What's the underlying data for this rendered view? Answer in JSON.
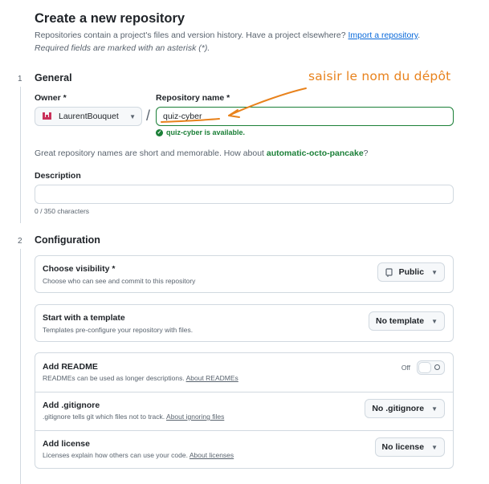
{
  "header": {
    "title": "Create a new repository",
    "intro_text": "Repositories contain a project's files and version history. Have a project elsewhere? ",
    "import_link": "Import a repository",
    "intro_end": ".",
    "required_note": "Required fields are marked with an asterisk (*)."
  },
  "general": {
    "step_number": "1",
    "title": "General",
    "owner_label": "Owner *",
    "owner_value": "LaurentBouquet",
    "slash": "/",
    "repo_label": "Repository name *",
    "repo_value": "quiz-cyber",
    "availability": "quiz-cyber is available.",
    "suggestion_prefix": "Great repository names are short and memorable. How about ",
    "suggestion_name": "automatic-octo-pancake",
    "suggestion_suffix": "?",
    "description_label": "Description",
    "description_value": "",
    "char_count": "0 / 350 characters"
  },
  "configuration": {
    "step_number": "2",
    "title": "Configuration",
    "visibility": {
      "title": "Choose visibility *",
      "subtitle": "Choose who can see and commit to this repository",
      "value": "Public"
    },
    "template": {
      "title": "Start with a template",
      "subtitle": "Templates pre-configure your repository with files.",
      "value": "No template"
    },
    "readme": {
      "title": "Add README",
      "subtitle": "READMEs can be used as longer descriptions. ",
      "link": "About READMEs",
      "toggle_state": "Off"
    },
    "gitignore": {
      "title": "Add .gitignore",
      "subtitle": ".gitignore tells git which files not to track. ",
      "link": "About ignoring files",
      "value": "No .gitignore"
    },
    "license": {
      "title": "Add license",
      "subtitle": "Licenses explain how others can use your code. ",
      "link": "About licenses",
      "value": "No license"
    }
  },
  "annotation": {
    "text": "saisir le nom du dépôt",
    "color": "#e8821c"
  },
  "colors": {
    "success": "#1a7f37",
    "link": "#0969da",
    "border": "#d1d9e0",
    "muted": "#59636e"
  },
  "icons": {
    "owner_avatar": "github-identicon",
    "availability": "check-circle-icon",
    "visibility": "repo-icon",
    "toggle": "toggle-off-icon"
  }
}
